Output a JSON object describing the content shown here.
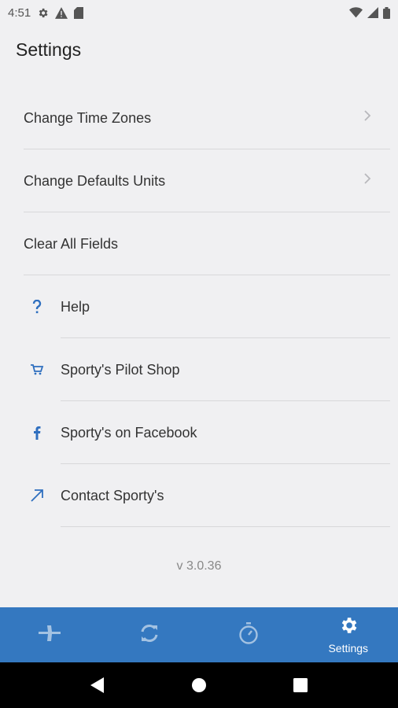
{
  "status_bar": {
    "time": "4:51",
    "left_icons": [
      "gear-icon",
      "warning-icon",
      "sd-card-icon"
    ],
    "right_icons": [
      "wifi-icon",
      "signal-icon",
      "battery-icon"
    ]
  },
  "header": {
    "title": "Settings"
  },
  "menu": {
    "items": [
      {
        "label": "Change Time Zones",
        "icon": null,
        "has_chevron": true
      },
      {
        "label": "Change Defaults Units",
        "icon": null,
        "has_chevron": true
      },
      {
        "label": "Clear All Fields",
        "icon": null,
        "has_chevron": false
      },
      {
        "label": "Help",
        "icon": "question-icon",
        "has_chevron": false
      },
      {
        "label": "Sporty's Pilot Shop",
        "icon": "cart-icon",
        "has_chevron": false
      },
      {
        "label": "Sporty's on Facebook",
        "icon": "facebook-icon",
        "has_chevron": false
      },
      {
        "label": "Contact Sporty's",
        "icon": "external-arrow-icon",
        "has_chevron": false
      }
    ]
  },
  "version": "v 3.0.36",
  "bottom_nav": {
    "items": [
      {
        "icon": "airplane-icon",
        "label": "",
        "active": false
      },
      {
        "icon": "sync-icon",
        "label": "",
        "active": false
      },
      {
        "icon": "stopwatch-icon",
        "label": "",
        "active": false
      },
      {
        "icon": "gear-icon",
        "label": "Settings",
        "active": true
      }
    ]
  },
  "android_nav": {
    "buttons": [
      "back-icon",
      "home-icon",
      "recents-icon"
    ]
  },
  "colors": {
    "accent": "#3478c0",
    "background": "#f0f0f2",
    "icon_blue": "#2f6fbf"
  }
}
